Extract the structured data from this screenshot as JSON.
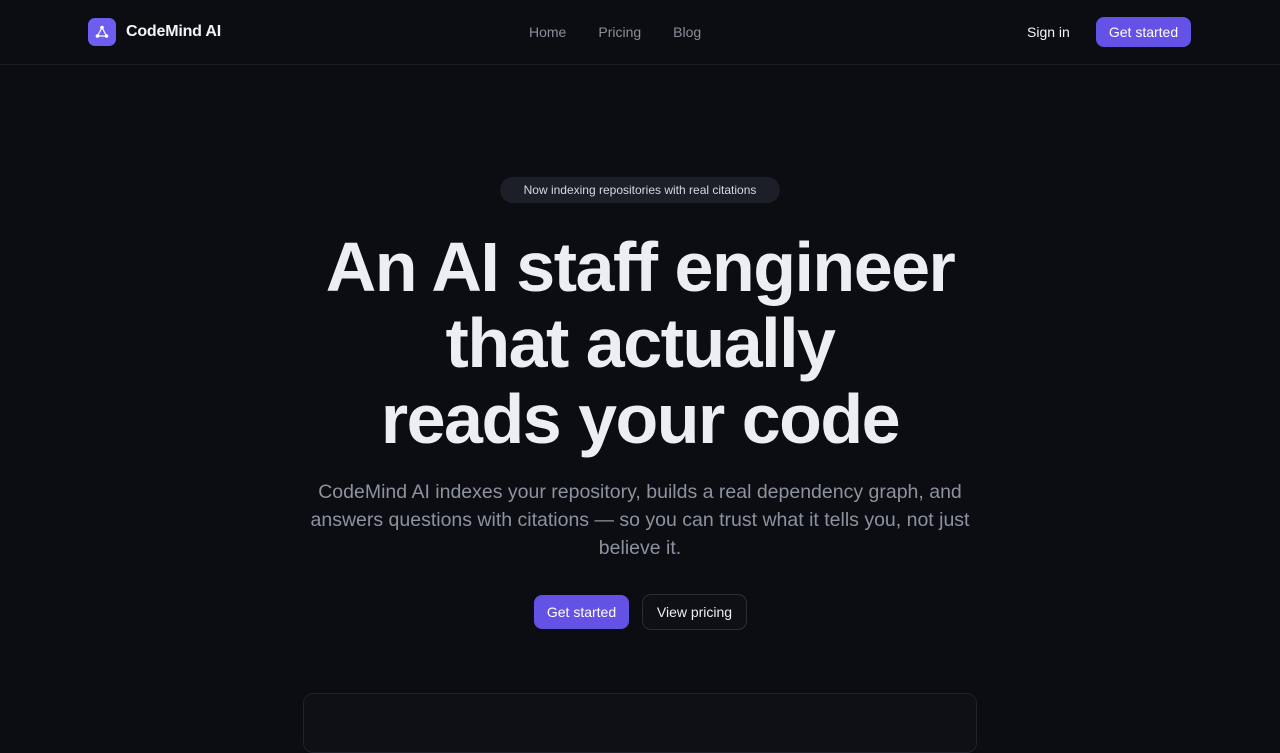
{
  "header": {
    "brand_name": "CodeMind AI",
    "brand_icon": "graph-nodes-icon",
    "nav": [
      {
        "label": "Home"
      },
      {
        "label": "Pricing"
      },
      {
        "label": "Blog"
      }
    ],
    "sign_in_label": "Sign in",
    "cta_label": "Get started"
  },
  "hero": {
    "badge": "Now indexing repositories with real citations",
    "headline_lines": [
      "An AI staff engineer",
      "that actually",
      "reads your code"
    ],
    "subheadline": "CodeMind AI indexes your repository, builds a real dependency graph, and answers questions with citations — so you can trust what it tells you, not just believe it.",
    "primary_cta": "Get started",
    "secondary_cta": "View pricing"
  },
  "colors": {
    "background": "#0b0d12",
    "accent": "#6452e6",
    "text_primary": "#eceef3",
    "text_muted": "#8d92a0"
  }
}
